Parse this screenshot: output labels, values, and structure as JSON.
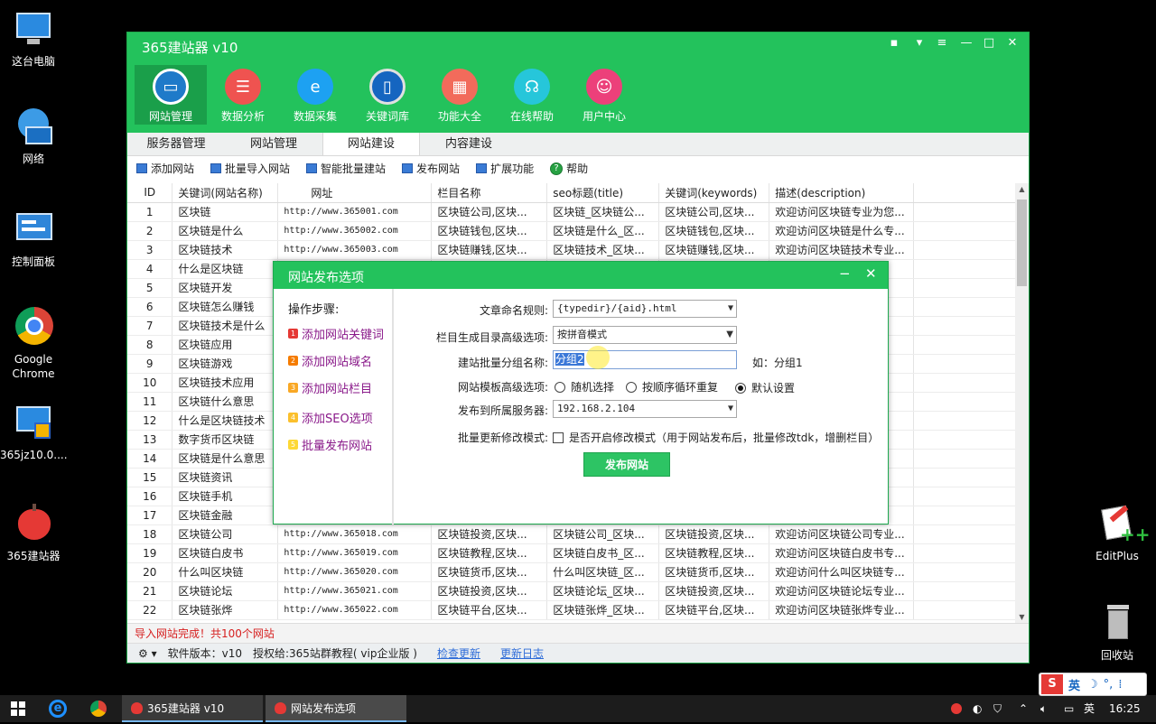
{
  "desktop": {
    "icons": [
      {
        "label": "这台电脑"
      },
      {
        "label": "网络"
      },
      {
        "label": "控制面板"
      },
      {
        "label": "Google Chrome"
      },
      {
        "label": "365jz10.0...."
      },
      {
        "label": "365建站器"
      },
      {
        "label": "EditPlus"
      },
      {
        "label": "回收站"
      }
    ]
  },
  "app": {
    "title": "365建站器 v10",
    "nav": [
      {
        "label": "网站管理",
        "color": "#1e7ac9"
      },
      {
        "label": "数据分析",
        "color": "#ef5350"
      },
      {
        "label": "数据采集",
        "color": "#1da1f2"
      },
      {
        "label": "关键词库",
        "color": "#1565c0"
      },
      {
        "label": "功能大全",
        "color": "#f26b5b"
      },
      {
        "label": "在线帮助",
        "color": "#26c6da"
      },
      {
        "label": "用户中心",
        "color": "#ec407a"
      }
    ],
    "subtabs": [
      "服务器管理",
      "网站管理",
      "网站建设",
      "内容建设"
    ],
    "toolbar": [
      "添加网站",
      "批量导入网站",
      "智能批量建站",
      "发布网站",
      "扩展功能",
      "帮助"
    ],
    "columns": [
      "ID",
      "关键词(网站名称)",
      "网址",
      "栏目名称",
      "seo标题(title)",
      "关键词(keywords)",
      "描述(description)"
    ],
    "rows": [
      [
        "1",
        "区块链",
        "http://www.365001.com",
        "区块链公司,区块...",
        "区块链_区块链公...",
        "区块链公司,区块...",
        "欢迎访问区块链专业为您..."
      ],
      [
        "2",
        "区块链是什么",
        "http://www.365002.com",
        "区块链钱包,区块...",
        "区块链是什么_区...",
        "区块链钱包,区块...",
        "欢迎访问区块链是什么专..."
      ],
      [
        "3",
        "区块链技术",
        "http://www.365003.com",
        "区块链赚钱,区块...",
        "区块链技术_区块...",
        "区块链赚钱,区块...",
        "欢迎访问区块链技术专业..."
      ],
      [
        "4",
        "什么是区块链",
        "",
        "",
        "",
        "",
        "专..."
      ],
      [
        "5",
        "区块链开发",
        "",
        "",
        "",
        "",
        "业..."
      ],
      [
        "6",
        "区块链怎么赚钱",
        "",
        "",
        "",
        "",
        "钱..."
      ],
      [
        "7",
        "区块链技术是什么",
        "",
        "",
        "",
        "",
        "什..."
      ],
      [
        "8",
        "区块链应用",
        "",
        "",
        "",
        "",
        "业..."
      ],
      [
        "9",
        "区块链游戏",
        "",
        "",
        "",
        "",
        "业..."
      ],
      [
        "10",
        "区块链技术应用",
        "",
        "",
        "",
        "",
        "用..."
      ],
      [
        "11",
        "区块链什么意思",
        "",
        "",
        "",
        "",
        "思..."
      ],
      [
        "12",
        "什么是区块链技术",
        "",
        "",
        "",
        "",
        "技..."
      ],
      [
        "13",
        "数字货币区块链",
        "",
        "",
        "",
        "",
        "链..."
      ],
      [
        "14",
        "区块链是什么意思",
        "",
        "",
        "",
        "",
        "么..."
      ],
      [
        "15",
        "区块链资讯",
        "",
        "",
        "",
        "",
        "业..."
      ],
      [
        "16",
        "区块链手机",
        "",
        "",
        "",
        "",
        "业..."
      ],
      [
        "17",
        "区块链金融",
        "",
        "",
        "",
        "",
        "业..."
      ],
      [
        "18",
        "区块链公司",
        "http://www.365018.com",
        "区块链投资,区块...",
        "区块链公司_区块...",
        "区块链投资,区块...",
        "欢迎访问区块链公司专业..."
      ],
      [
        "19",
        "区块链白皮书",
        "http://www.365019.com",
        "区块链教程,区块...",
        "区块链白皮书_区...",
        "区块链教程,区块...",
        "欢迎访问区块链白皮书专..."
      ],
      [
        "20",
        "什么叫区块链",
        "http://www.365020.com",
        "区块链货币,区块...",
        "什么叫区块链_区...",
        "区块链货币,区块...",
        "欢迎访问什么叫区块链专..."
      ],
      [
        "21",
        "区块链论坛",
        "http://www.365021.com",
        "区块链投资,区块...",
        "区块链论坛_区块...",
        "区块链投资,区块...",
        "欢迎访问区块链论坛专业..."
      ],
      [
        "22",
        "区块链张烨",
        "http://www.365022.com",
        "区块链平台,区块...",
        "区块链张烨_区块...",
        "区块链平台,区块...",
        "欢迎访问区块链张烨专业..."
      ]
    ],
    "status_message": "导入网站完成！共100个网站",
    "footer": {
      "version": "软件版本：v10",
      "license": "授权给:365站群教程( vip企业版 )",
      "check_update": "检查更新",
      "update_log": "更新日志"
    }
  },
  "dialog": {
    "title": "网站发布选项",
    "steps_title": "操作步骤:",
    "steps": [
      {
        "num": "1",
        "label": "添加网站关键词",
        "color": "#e53935"
      },
      {
        "num": "2",
        "label": "添加网站域名",
        "color": "#f57c00"
      },
      {
        "num": "3",
        "label": "添加网站栏目",
        "color": "#f9a825"
      },
      {
        "num": "4",
        "label": "添加SEO选项",
        "color": "#fbc02d"
      },
      {
        "num": "5",
        "label": "批量发布网站",
        "color": "#fdd835"
      }
    ],
    "fields": {
      "naming_label": "文章命名规则:",
      "naming_value": "{typedir}/{aid}.html",
      "dir_label": "栏目生成目录高级选项:",
      "dir_value": "按拼音模式",
      "group_label": "建站批量分组名称:",
      "group_value": "分组2",
      "group_hint": "如：分组1",
      "template_label": "网站模板高级选项:",
      "template_options": [
        "随机选择",
        "按顺序循环重复",
        "默认设置"
      ],
      "template_selected": "默认设置",
      "server_label": "发布到所属服务器:",
      "server_value": "192.168.2.104",
      "update_label": "批量更新修改模式:",
      "update_checkbox": "是否开启修改模式（用于网站发布后，批量修改tdk，增删栏目）"
    },
    "publish_button": "发布网站"
  },
  "taskbar": {
    "tasks": [
      "365建站器 v10",
      "网站发布选项"
    ],
    "ime": "英",
    "ime_tray": "英",
    "time": "16:25"
  }
}
